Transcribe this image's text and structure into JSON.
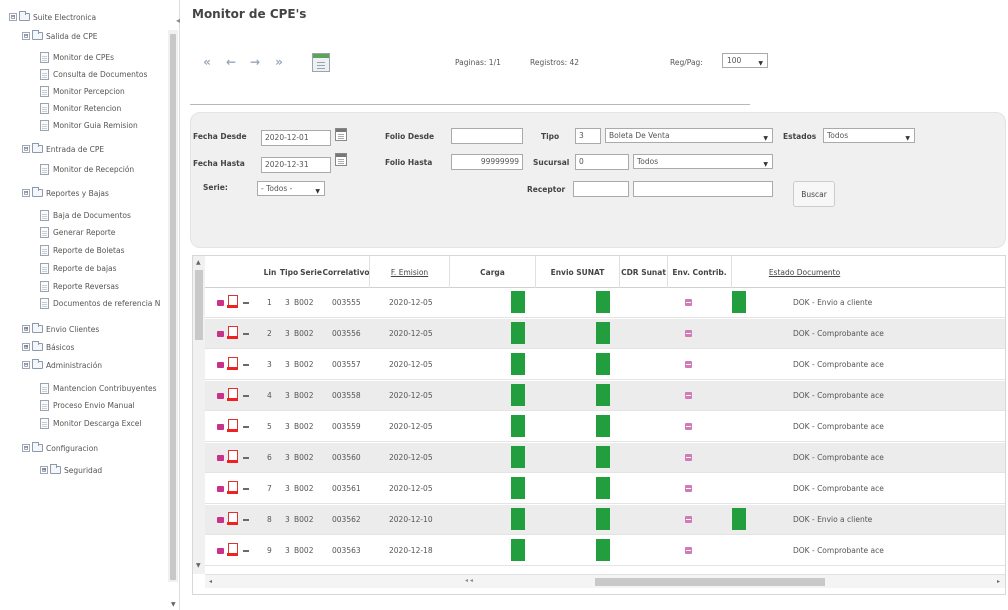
{
  "sidebar": {
    "items": [
      {
        "label": "Suite Electronica",
        "type": "folder",
        "toggle": "⊟",
        "level": 0
      },
      {
        "label": "Salida de CPE",
        "type": "folder",
        "toggle": "⊟",
        "level": 1
      },
      {
        "label": "Monitor de CPEs",
        "type": "doc",
        "level": 2
      },
      {
        "label": "Consulta de Documentos",
        "type": "doc",
        "level": 2
      },
      {
        "label": "Monitor Percepcion",
        "type": "doc",
        "level": 2
      },
      {
        "label": "Monitor Retencion",
        "type": "doc",
        "level": 2
      },
      {
        "label": "Monitor Guia Remision",
        "type": "doc",
        "level": 2
      },
      {
        "label": "Entrada de CPE",
        "type": "folder",
        "toggle": "⊟",
        "level": 1
      },
      {
        "label": "Monitor de Recepción",
        "type": "doc",
        "level": 2
      },
      {
        "label": "Reportes y Bajas",
        "type": "folder",
        "toggle": "⊟",
        "level": 1
      },
      {
        "label": "Baja de Documentos",
        "type": "doc",
        "level": 2
      },
      {
        "label": "Generar Reporte",
        "type": "doc",
        "level": 2
      },
      {
        "label": "Reporte de Boletas",
        "type": "doc",
        "level": 2
      },
      {
        "label": "Reporte de bajas",
        "type": "doc",
        "level": 2
      },
      {
        "label": "Reporte Reversas",
        "type": "doc",
        "level": 2
      },
      {
        "label": "Documentos de referencia N",
        "type": "doc",
        "level": 2
      },
      {
        "label": "Envio Clientes",
        "type": "folder",
        "toggle": "⊞",
        "level": 1
      },
      {
        "label": "Básicos",
        "type": "folder",
        "toggle": "⊞",
        "level": 1
      },
      {
        "label": "Administración",
        "type": "folder",
        "toggle": "⊟",
        "level": 1
      },
      {
        "label": "Mantencion Contribuyentes",
        "type": "doc",
        "level": 2
      },
      {
        "label": "Proceso Envio Manual",
        "type": "doc",
        "level": 2
      },
      {
        "label": "Monitor Descarga Excel",
        "type": "doc",
        "level": 2
      },
      {
        "label": "Configuracion",
        "type": "folder",
        "toggle": "⊟",
        "level": 1
      },
      {
        "label": "Seguridad",
        "type": "folder",
        "toggle": "⊞",
        "level": 2
      }
    ]
  },
  "header": {
    "title": "Monitor de CPE's",
    "collapse_glyph": "◂"
  },
  "toolbar": {
    "first": "«",
    "prev": "←",
    "next": "→",
    "last": "»",
    "paginas": "Paginas: 1/1",
    "registros": "Registros: 42",
    "regpag_label": "Reg/Pag:",
    "regpag_value": "100"
  },
  "filters": {
    "fecha_desde_label": "Fecha Desde",
    "fecha_desde_value": "2020-12-01",
    "fecha_hasta_label": "Fecha Hasta",
    "fecha_hasta_value": "2020-12-31",
    "serie_label": "Serie:",
    "serie_value": "- Todos -",
    "folio_desde_label": "Folio Desde",
    "folio_desde_value": "",
    "folio_hasta_label": "Folio Hasta",
    "folio_hasta_value": "99999999",
    "tipo_label": "Tipo",
    "tipo_code": "3",
    "tipo_value": "Boleta De Venta",
    "sucursal_label": "Sucursal",
    "sucursal_code": "0",
    "sucursal_value": "Todos",
    "receptor_label": "Receptor",
    "receptor_code": "",
    "receptor_name": "",
    "estados_label": "Estados",
    "estados_value": "Todos",
    "buscar_label": "Buscar"
  },
  "grid": {
    "headers": {
      "lin": "Lin",
      "tipo": "Tipo",
      "serie": "Serie",
      "correlativo": "Correlativo",
      "emision": "F. Emision",
      "carga": "Carga",
      "envio": "Envio SUNAT",
      "cdr": "CDR Sunat",
      "envc": "Env. Contrib.",
      "estado": "Estado Documento"
    },
    "rows": [
      {
        "lin": "1",
        "tipo": "3",
        "serie": "B002",
        "correlativo": "003555",
        "emision": "2020-12-05",
        "carga": true,
        "envio": true,
        "cdr": true,
        "envc": true,
        "estado": "DOK - Envio a cliente"
      },
      {
        "lin": "2",
        "tipo": "3",
        "serie": "B002",
        "correlativo": "003556",
        "emision": "2020-12-05",
        "carga": true,
        "envio": true,
        "cdr": true,
        "envc": false,
        "estado": "DOK - Comprobante ace"
      },
      {
        "lin": "3",
        "tipo": "3",
        "serie": "B002",
        "correlativo": "003557",
        "emision": "2020-12-05",
        "carga": true,
        "envio": true,
        "cdr": true,
        "envc": false,
        "estado": "DOK - Comprobante ace"
      },
      {
        "lin": "4",
        "tipo": "3",
        "serie": "B002",
        "correlativo": "003558",
        "emision": "2020-12-05",
        "carga": true,
        "envio": true,
        "cdr": true,
        "envc": false,
        "estado": "DOK - Comprobante ace"
      },
      {
        "lin": "5",
        "tipo": "3",
        "serie": "B002",
        "correlativo": "003559",
        "emision": "2020-12-05",
        "carga": true,
        "envio": true,
        "cdr": true,
        "envc": false,
        "estado": "DOK - Comprobante ace"
      },
      {
        "lin": "6",
        "tipo": "3",
        "serie": "B002",
        "correlativo": "003560",
        "emision": "2020-12-05",
        "carga": true,
        "envio": true,
        "cdr": true,
        "envc": false,
        "estado": "DOK - Comprobante ace"
      },
      {
        "lin": "7",
        "tipo": "3",
        "serie": "B002",
        "correlativo": "003561",
        "emision": "2020-12-05",
        "carga": true,
        "envio": true,
        "cdr": true,
        "envc": false,
        "estado": "DOK - Comprobante ace"
      },
      {
        "lin": "8",
        "tipo": "3",
        "serie": "B002",
        "correlativo": "003562",
        "emision": "2020-12-10",
        "carga": true,
        "envio": true,
        "cdr": true,
        "envc": true,
        "estado": "DOK - Envio a cliente"
      },
      {
        "lin": "9",
        "tipo": "3",
        "serie": "B002",
        "correlativo": "003563",
        "emision": "2020-12-18",
        "carga": true,
        "envio": true,
        "cdr": true,
        "envc": false,
        "estado": "DOK - Comprobante ace"
      }
    ]
  },
  "colors": {
    "status_green": "#239e3e",
    "pdf_red": "#e22222",
    "cdr_pink": "#d27ab8"
  },
  "icons": {
    "first": "first-page-icon",
    "prev": "prev-page-icon",
    "next": "next-page-icon",
    "last": "last-page-icon",
    "excel": "excel-export-icon",
    "calendar": "calendar-icon",
    "pdf": "pdf-icon",
    "folder": "folder-icon",
    "document": "document-icon"
  }
}
